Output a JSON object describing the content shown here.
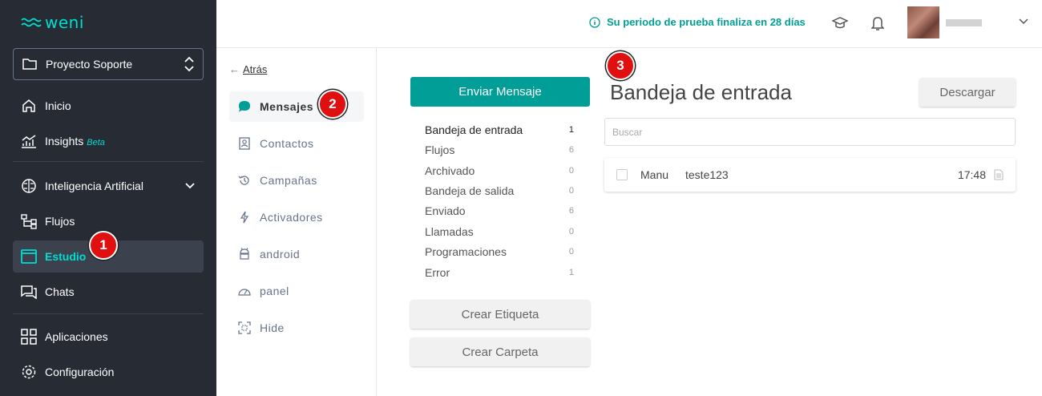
{
  "app": {
    "logo_text": "weni"
  },
  "sidebar": {
    "project": "Proyecto Soporte",
    "items": [
      {
        "label": "Inicio",
        "icon": "home-icon"
      },
      {
        "label": "Insights",
        "badge": "Beta",
        "icon": "insights-icon"
      },
      {
        "label": "Inteligencia Artificial",
        "icon": "brain-icon"
      },
      {
        "label": "Flujos",
        "icon": "flows-icon"
      },
      {
        "label": "Estudio",
        "icon": "studio-icon"
      },
      {
        "label": "Chats",
        "icon": "chats-icon"
      },
      {
        "label": "Aplicaciones",
        "icon": "apps-icon"
      },
      {
        "label": "Configuración",
        "icon": "gear-icon"
      }
    ],
    "active": "Estudio"
  },
  "header": {
    "trial_text": "Su periodo de prueba finaliza en 28 días"
  },
  "submenu": {
    "back_arrow": "←",
    "back_label": "Atrás",
    "items": [
      {
        "label": "Mensajes",
        "icon": "message-icon"
      },
      {
        "label": "Contactos",
        "icon": "contact-icon"
      },
      {
        "label": "Campañas",
        "icon": "history-icon"
      },
      {
        "label": "Activadores",
        "icon": "bolt-icon"
      },
      {
        "label": "android",
        "icon": "android-icon"
      },
      {
        "label": "panel",
        "icon": "gauge-icon"
      },
      {
        "label": "Hide",
        "icon": "hide-icon"
      }
    ]
  },
  "folders": {
    "send_button": "Enviar Mensaje",
    "items": [
      {
        "label": "Bandeja de entrada",
        "count": "1"
      },
      {
        "label": "Flujos",
        "count": "6"
      },
      {
        "label": "Archivado",
        "count": "0"
      },
      {
        "label": "Bandeja de salida",
        "count": "0"
      },
      {
        "label": "Enviado",
        "count": "6"
      },
      {
        "label": "Llamadas",
        "count": "0"
      },
      {
        "label": "Programaciones",
        "count": "0"
      },
      {
        "label": "Error",
        "count": "1"
      }
    ],
    "create_label_button": "Crear Etiqueta",
    "create_folder_button": "Crear Carpeta"
  },
  "inbox": {
    "title": "Bandeja de entrada",
    "download_button": "Descargar",
    "search_placeholder": "Buscar",
    "messages": [
      {
        "from": "Manu",
        "text": "teste123",
        "time": "17:48"
      }
    ]
  },
  "annotations": [
    "1",
    "2",
    "3"
  ],
  "colors": {
    "sidebar_bg": "#272b33",
    "accent": "#00ded2",
    "primary": "#009e96",
    "badge": "#e01010"
  }
}
